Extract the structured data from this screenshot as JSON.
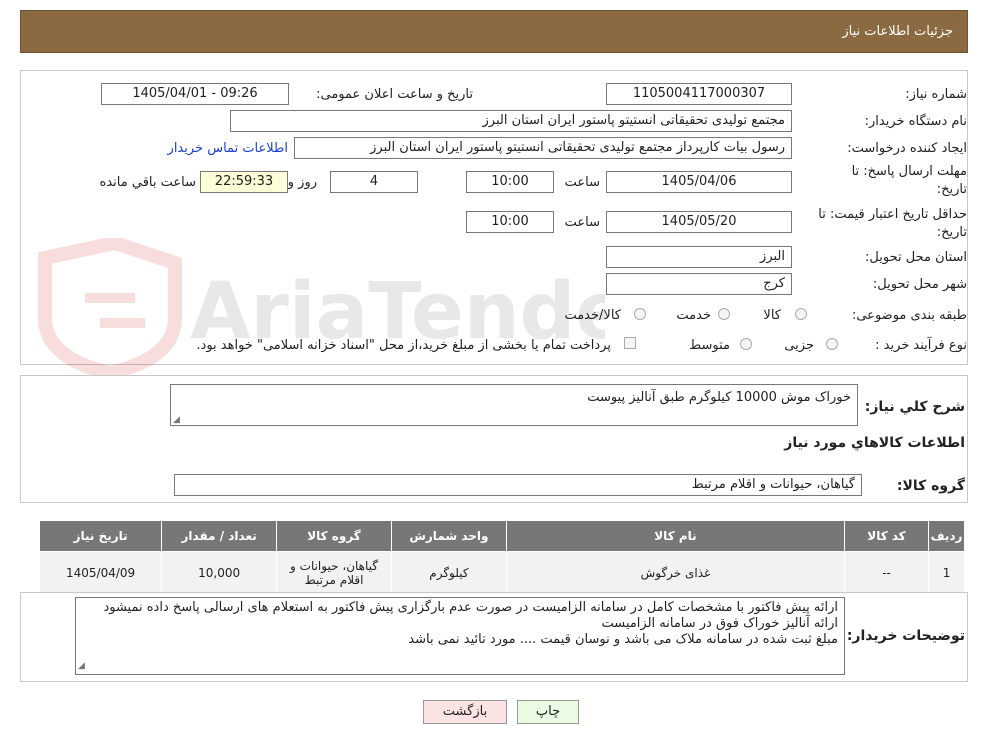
{
  "header": {
    "title": "جزئیات اطلاعات نیاز"
  },
  "fields": {
    "need_number_label": "شماره نیاز:",
    "need_number": "1105004117000307",
    "announce_label": "تاریخ و ساعت اعلان عمومی:",
    "announce_value": "1405/04/01 - 09:26",
    "buyer_label": "نام دستگاه خریدار:",
    "buyer_value": "مجتمع تولیدی تحقیقاتی انستیتو پاستور ایران استان البرز",
    "creator_label": "ایجاد کننده درخواست:",
    "creator_value": "رسول بیات کارپرداز مجتمع تولیدی تحقیقاتی انستیتو پاستور ایران استان البرز",
    "contact_link": "اطلاعات تماس خریدار",
    "deadline_label_1": "مهلت ارسال پاسخ: تا",
    "deadline_label_2": "تاریخ:",
    "deadline_date": "1405/04/06",
    "time_label": "ساعت",
    "deadline_time": "10:00",
    "days_value": "4",
    "days_label": "روز و",
    "remaining_time": "22:59:33",
    "remaining_label": "ساعت باقي مانده",
    "validity_label_1": "حداقل تاریخ اعتبار قیمت: تا",
    "validity_label_2": "تاریخ:",
    "validity_date": "1405/05/20",
    "validity_time": "10:00",
    "province_label": "استان محل تحویل:",
    "province_value": "البرز",
    "city_label": "شهر محل تحویل:",
    "city_value": "کرج",
    "category_label": "طبقه بندی موضوعی:",
    "category_options": [
      "کالا",
      "خدمت",
      "کالا/خدمت"
    ],
    "process_label": "نوع فرآیند خرید :",
    "process_options": [
      "جزیی",
      "متوسط"
    ],
    "payment_note": "پرداخت تمام یا بخشی از مبلغ خرید،از محل \"اسناد خزانه اسلامی\" خواهد بود."
  },
  "summary": {
    "label": "شرح کلي نياز:",
    "value": "خوراک موش 10000 کیلوگرم طبق آنالیز پیوست",
    "goods_info_title": "اطلاعات کالاهاي مورد نياز",
    "group_label": "گروه کالا:",
    "group_value": "گیاهان، حیوانات و اقلام مرتبط"
  },
  "table": {
    "headers": [
      "رديف",
      "کد کالا",
      "نام کالا",
      "واحد شمارش",
      "گروه کالا",
      "تعداد / مقدار",
      "تاریخ نیاز"
    ],
    "rows": [
      [
        "1",
        "--",
        "غذای خرگوش",
        "کیلوگرم",
        "گیاهان، حیوانات و اقلام مرتبط",
        "10,000",
        "1405/04/09"
      ]
    ]
  },
  "buyer_notes": {
    "label": "توضیحات خریدار:",
    "lines": [
      "ارائه پیش فاکتور با مشخصات کامل در سامانه الزامیست در صورت عدم بارگزاری پیش فاکتور به استعلام های ارسالی پاسخ داده نمیشود",
      "ارائه آنالیز خوراک فوق در سامانه الزامیست",
      "مبلغ ثبت شده در سامانه ملاک می باشد و نوسان قیمت .... مورد تائید نمی باشد"
    ]
  },
  "buttons": {
    "print": "چاپ",
    "back": "بازگشت"
  },
  "colors": {
    "header_bg": "#8b6a42",
    "table_header_bg": "#777777",
    "print_btn_bg": "#eafbe3",
    "back_btn_bg": "#fbe3e3",
    "link": "#1a3fd0"
  }
}
